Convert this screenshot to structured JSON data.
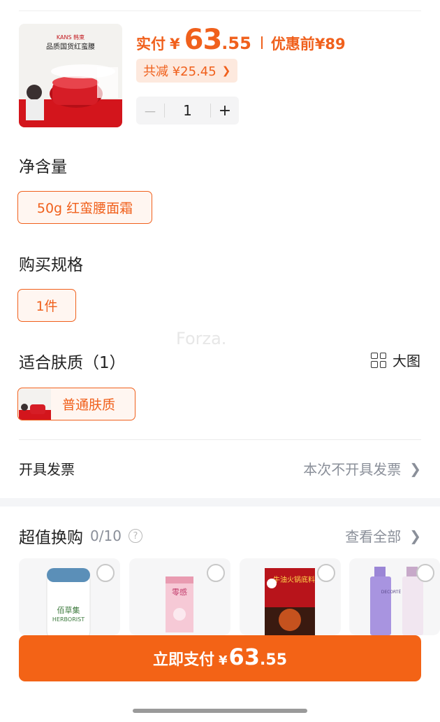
{
  "product": {
    "image_brand": "KANS 韩束",
    "image_tagline": "品质国货红蛮腰",
    "price_label": "实付",
    "currency": "¥",
    "price_int": "63",
    "price_dec": ".55",
    "original_label": "优惠前",
    "original_price": "¥89",
    "discount_text": "共减 ¥25.45",
    "quantity": "1",
    "minus_symbol": "－",
    "plus_symbol": "+"
  },
  "sections": {
    "net_content_title": "净含量",
    "net_content_option": "50g 红蛮腰面霜",
    "spec_title": "购买规格",
    "spec_option": "1件",
    "skin_title": "适合肤质（1）",
    "skin_option": "普通肤质",
    "big_view_label": "大图"
  },
  "invoice": {
    "label": "开具发票",
    "value": "本次不开具发票"
  },
  "trade": {
    "title": "超值换购",
    "count": "0/10",
    "see_all": "查看全部",
    "cards": [
      {
        "name": "佰草集",
        "brand": "HERBORIST"
      },
      {
        "name": "零感"
      },
      {
        "name": "牛油火锅底料"
      },
      {
        "name": "DECORTÉ"
      }
    ]
  },
  "pay_button": {
    "label": "立即支付",
    "currency": "¥",
    "int": "63",
    "dec": ".55"
  },
  "watermark": "Forza.",
  "colors": {
    "accent": "#f0601c",
    "button": "#f36316",
    "discount_bg": "#fde9de",
    "muted": "#8a8f99"
  }
}
